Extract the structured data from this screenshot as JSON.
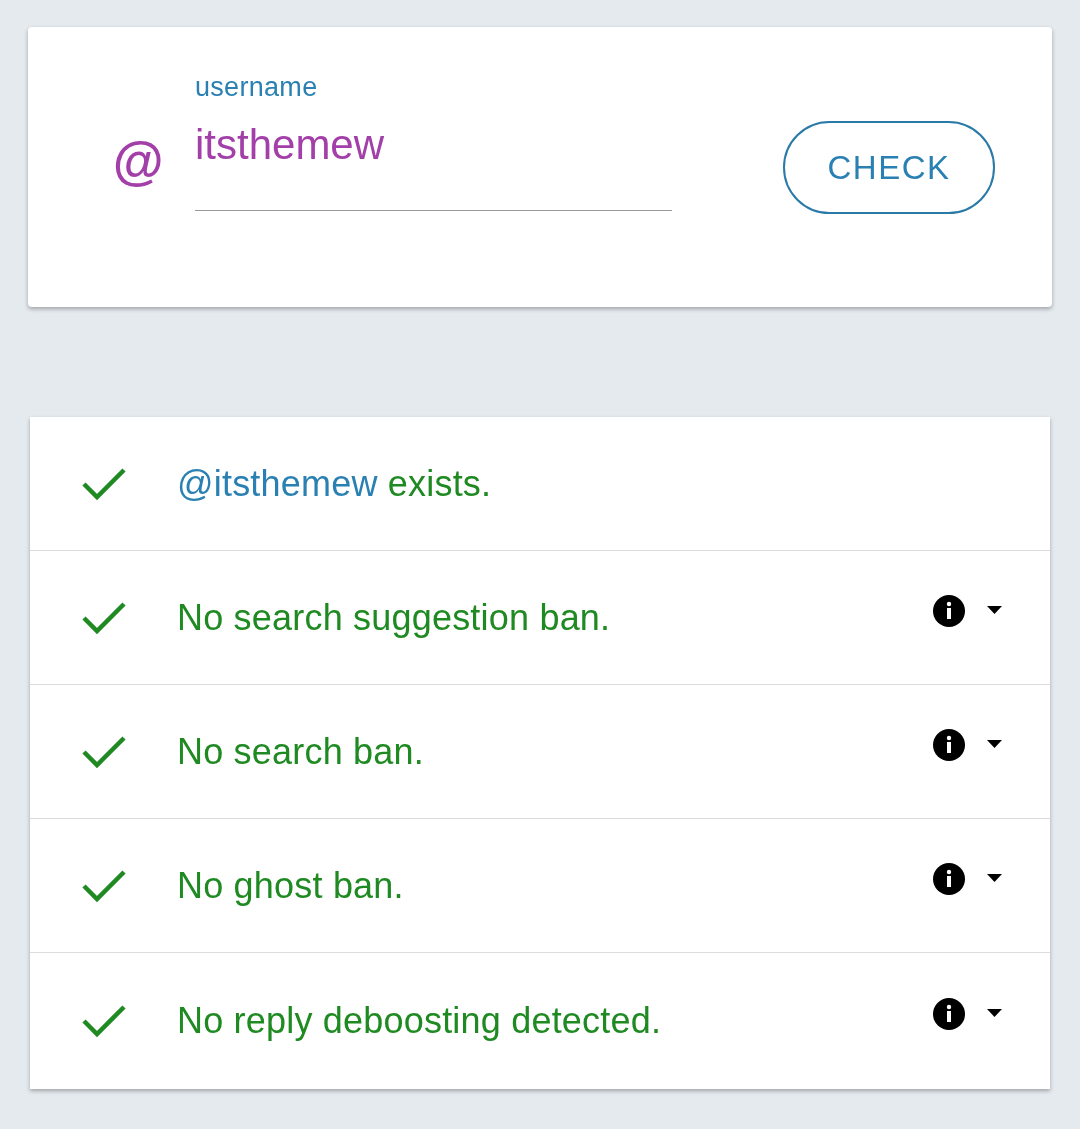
{
  "lookup": {
    "prefix": "@",
    "field": {
      "label": "username",
      "value": "itsthemew"
    },
    "button": "CHECK"
  },
  "results": [
    {
      "kind": "link",
      "passed": true,
      "link": "@itsthemew",
      "text": "exists.",
      "info": false
    },
    {
      "kind": "plain",
      "passed": true,
      "text": "No search suggestion ban.",
      "info": true,
      "expanded": false
    },
    {
      "kind": "plain",
      "passed": true,
      "text": "No search ban.",
      "info": true,
      "expanded": false
    },
    {
      "kind": "plain",
      "passed": true,
      "text": "No ghost ban.",
      "info": true,
      "expanded": false
    },
    {
      "kind": "plain",
      "passed": true,
      "text": "No reply deboosting detected.",
      "info": true,
      "expanded": false
    }
  ]
}
